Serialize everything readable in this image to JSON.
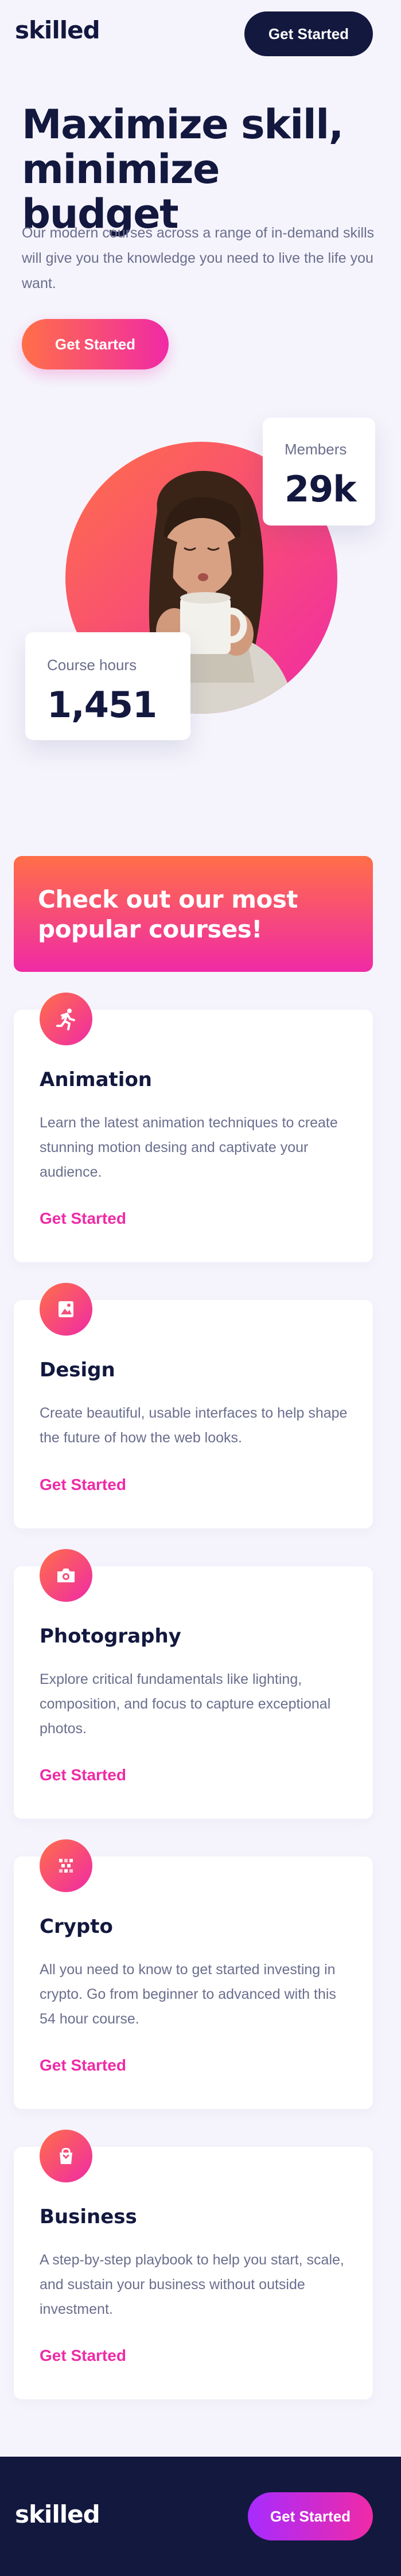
{
  "header": {
    "logo": "skilled",
    "cta_label": "Get Started"
  },
  "hero": {
    "title": "Maximize skill, minimize budget",
    "text": "Our modern courses across a range of in-demand skills will give you the knowledge you need to live the life you want.",
    "cta_label": "Get Started"
  },
  "stats": {
    "members": {
      "label": "Members",
      "value": "29k"
    },
    "hours": {
      "label": "Course hours",
      "value": "1,451"
    }
  },
  "courses": {
    "heading": "Check out our most popular courses!",
    "items": [
      {
        "icon": "running-figure-icon",
        "title": "Animation",
        "description": "Learn the latest animation techniques to create stunning motion desing and captivate your audience.",
        "link": "Get Started"
      },
      {
        "icon": "picture-frame-icon",
        "title": "Design",
        "description": "Create beautiful, usable interfaces to help shape the future of how the web looks.",
        "link": "Get Started"
      },
      {
        "icon": "camera-icon",
        "title": "Photography",
        "description": "Explore critical fundamentals like lighting, composition, and focus to capture exceptional photos.",
        "link": "Get Started"
      },
      {
        "icon": "crypto-icon",
        "title": "Crypto",
        "description": "All you need to know to get started investing in crypto. Go from beginner to advanced with this 54 hour course.",
        "link": "Get Started"
      },
      {
        "icon": "shopping-bag-icon",
        "title": "Business",
        "description": "A step-by-step playbook to help you start, scale, and sustain your business without outside investment.",
        "link": "Get Started"
      }
    ]
  },
  "footer": {
    "logo": "skilled",
    "cta_label": "Get Started"
  },
  "colors": {
    "navy": "#13183f",
    "accent_pink": "#f02aa6",
    "accent_orange": "#ff6f48",
    "footer_button_purple": "#a72bff",
    "page_background": "#f5f4fc"
  }
}
